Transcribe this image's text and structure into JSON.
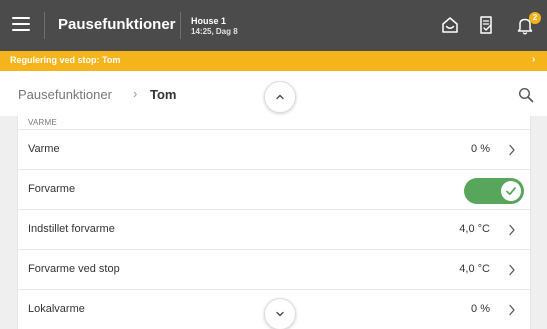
{
  "header": {
    "title": "Pausefunktioner",
    "house_name": "House 1",
    "house_time": "14:25, Dag 8",
    "notification_count": "2"
  },
  "alert": {
    "text": "Regulering ved stop: Tom"
  },
  "breadcrumb": {
    "root": "Pausefunktioner",
    "separator": "›",
    "current": "Tom"
  },
  "section": {
    "header": "VARME"
  },
  "rows": [
    {
      "label": "Varme",
      "value": "0 %"
    },
    {
      "label": "Forvarme",
      "toggle_on": true
    },
    {
      "label": "Indstillet forvarme",
      "value": "4,0 °C"
    },
    {
      "label": "Forvarme ved stop",
      "value": "4,0 °C"
    },
    {
      "label": "Lokalvarme",
      "value": "0 %"
    }
  ],
  "colors": {
    "topbar": "#4b4b4b",
    "alert": "#f5b41c",
    "toggle_on": "#58a55c",
    "badge": "#f2b31a"
  },
  "icons": {
    "menu": "hamburger-menu-icon",
    "house": "house-icon",
    "report": "report-icon",
    "notification": "bell-icon",
    "search": "search-icon",
    "scroll_up": "chevron-up-icon",
    "scroll_down": "chevron-down-icon"
  }
}
